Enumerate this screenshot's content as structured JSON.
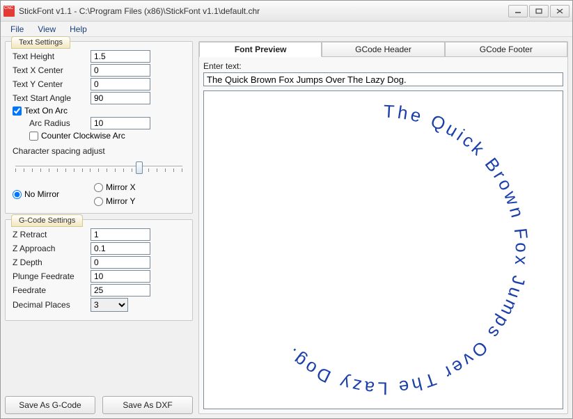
{
  "window": {
    "title": "StickFont v1.1 - C:\\Program Files (x86)\\StickFont v1.1\\default.chr"
  },
  "menu": {
    "file": "File",
    "view": "View",
    "help": "Help"
  },
  "text_settings": {
    "legend": "Text Settings",
    "height_label": "Text Height",
    "height_value": "1.5",
    "xcenter_label": "Text X Center",
    "xcenter_value": "0",
    "ycenter_label": "Text Y Center",
    "ycenter_value": "0",
    "start_angle_label": "Text Start Angle",
    "start_angle_value": "90",
    "text_on_arc_label": "Text On Arc",
    "text_on_arc_checked": true,
    "arc_radius_label": "Arc Radius",
    "arc_radius_value": "10",
    "ccw_label": "Counter Clockwise Arc",
    "ccw_checked": false,
    "char_spacing_label": "Character spacing adjust",
    "mirror_none": "No Mirror",
    "mirror_x": "Mirror X",
    "mirror_y": "Mirror Y",
    "mirror_selected": "none"
  },
  "gcode_settings": {
    "legend": "G-Code Settings",
    "zretract_label": "Z Retract",
    "zretract_value": "1",
    "zapproach_label": "Z Approach",
    "zapproach_value": "0.1",
    "zdepth_label": "Z Depth",
    "zdepth_value": "0",
    "plunge_feed_label": "Plunge Feedrate",
    "plunge_feed_value": "10",
    "feedrate_label": "Feedrate",
    "feedrate_value": "25",
    "decimal_label": "Decimal Places",
    "decimal_value": "3"
  },
  "buttons": {
    "save_gcode": "Save As G-Code",
    "save_dxf": "Save As DXF"
  },
  "preview": {
    "tab_preview": "Font Preview",
    "tab_header": "GCode Header",
    "tab_footer": "GCode Footer",
    "enter_label": "Enter text:",
    "text_value": "The Quick Brown Fox Jumps Over The Lazy Dog.",
    "arc_text": "The Quick Brown Fox Jumps Over The Lazy Dog. "
  }
}
